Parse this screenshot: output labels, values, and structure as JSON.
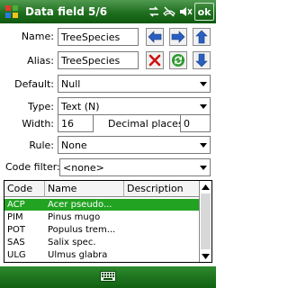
{
  "titlebar": {
    "title": "Data field 5/6",
    "ok_label": "ok",
    "icons": [
      "windows-flag-icon",
      "connectivity-icon",
      "phone-off-icon",
      "volume-mute-icon"
    ]
  },
  "form": {
    "name_label": "Name:",
    "name_value": "TreeSpecies",
    "alias_label": "Alias:",
    "alias_value": "TreeSpecies",
    "default_label": "Default:",
    "default_value": "Null",
    "type_label": "Type:",
    "type_value": "Text (N)",
    "width_label": "Width:",
    "width_value": "16",
    "decimal_label": "Decimal places:",
    "decimal_value": "0",
    "rule_label": "Rule:",
    "rule_value": "None",
    "code_filter_label": "Code filter:",
    "code_filter_value": "<none>"
  },
  "table": {
    "columns": [
      "Code",
      "Name",
      "Description"
    ],
    "rows": [
      {
        "code": "ACP",
        "name": "Acer pseudo...",
        "description": "",
        "selected": true
      },
      {
        "code": "PIM",
        "name": "Pinus mugo",
        "description": "",
        "selected": false
      },
      {
        "code": "POT",
        "name": "Populus trem...",
        "description": "",
        "selected": false
      },
      {
        "code": "SAS",
        "name": "Salix spec.",
        "description": "",
        "selected": false
      },
      {
        "code": "ULG",
        "name": "Ulmus glabra",
        "description": "",
        "selected": false
      }
    ]
  },
  "colors": {
    "titlebar_green": "#1f6e1f",
    "selection_green": "#22a322",
    "arrow_blue": "#2a5fc0",
    "delete_red": "#d01010"
  },
  "bottombar": {
    "icon": "keyboard-icon"
  }
}
